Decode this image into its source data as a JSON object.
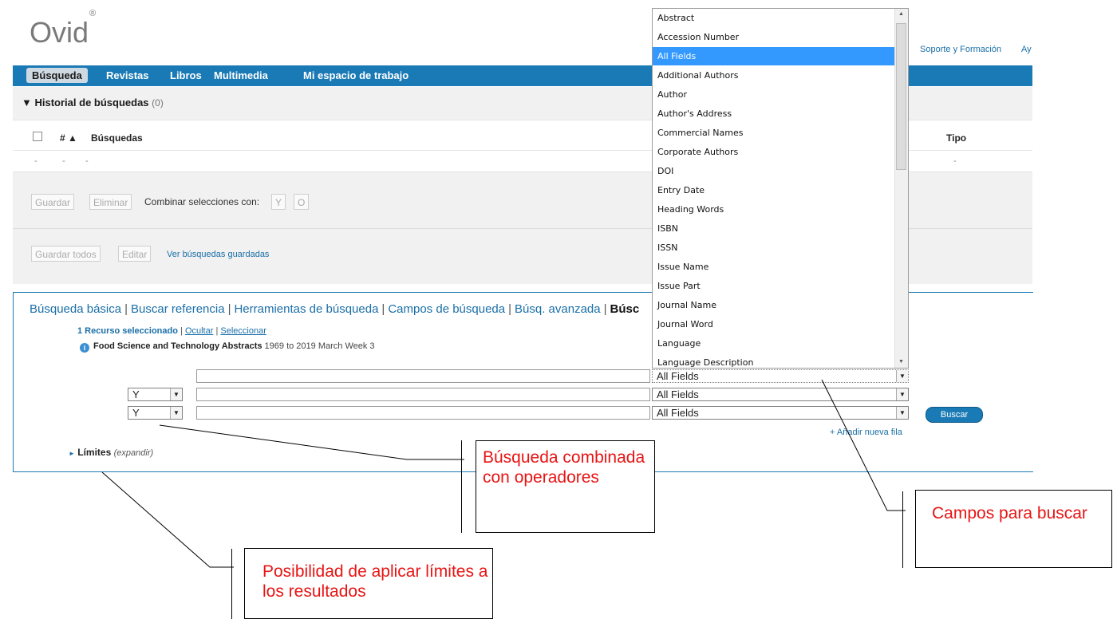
{
  "header": {
    "logo": "Ovid",
    "logo_mark": "®",
    "links": [
      "Soporte y Formación",
      "Ay"
    ]
  },
  "nav": {
    "items": [
      "Búsqueda",
      "Revistas",
      "Libros",
      "Multimedia",
      "Mi espacio de trabajo"
    ],
    "active": "Búsqueda"
  },
  "history": {
    "title": "Historial de búsquedas",
    "count": "(0)",
    "columns": {
      "hash": "#",
      "searches": "Búsquedas",
      "type": "Tipo"
    },
    "empty_row": [
      "-",
      "-",
      "-"
    ],
    "type_dash": "-",
    "guardar": "Guardar",
    "eliminar": "Eliminar",
    "combinar": "Combinar selecciones con:",
    "op_y": "Y",
    "op_o": "O",
    "guardar_todos": "Guardar todos",
    "editar": "Editar",
    "ver_guardadas": "Ver búsquedas guardadas"
  },
  "search": {
    "tabs": [
      "Búsqueda básica",
      "Buscar referencia",
      "Herramientas de búsqueda",
      "Campos de búsqueda",
      "Búsq. avanzada",
      "Búsc"
    ],
    "resource_selected": "1 Recurso seleccionado",
    "ocultar": "Ocultar",
    "seleccionar": "Seleccionar",
    "database": "Food Science and Technology Abstracts",
    "database_range": "1969 to 2019 March Week 3",
    "rows": [
      {
        "operator": "",
        "field": "All Fields"
      },
      {
        "operator": "Y",
        "field": "All Fields"
      },
      {
        "operator": "Y",
        "field": "All Fields"
      }
    ],
    "buscar": "Buscar",
    "add_row": "+ Añadir nueva fila",
    "limits": "Límites",
    "limits_hint": "(expandir)"
  },
  "dropdown": {
    "options": [
      "Abstract",
      "Accession Number",
      "All Fields",
      "Additional Authors",
      "Author",
      "Author's Address",
      "Commercial Names",
      "Corporate Authors",
      "DOI",
      "Entry Date",
      "Heading Words",
      "ISBN",
      "ISSN",
      "Issue Name",
      "Issue Part",
      "Journal Name",
      "Journal Word",
      "Language",
      "Language Description"
    ],
    "selected": "All Fields"
  },
  "annotations": {
    "operators": "Búsqueda combinada con operadores",
    "fields": "Campos para buscar",
    "limits": "Posibilidad de aplicar límites a los resultados"
  },
  "colors": {
    "accent": "#1a7ab5",
    "annotation_text": "#e81414",
    "selection": "#3399ff"
  }
}
